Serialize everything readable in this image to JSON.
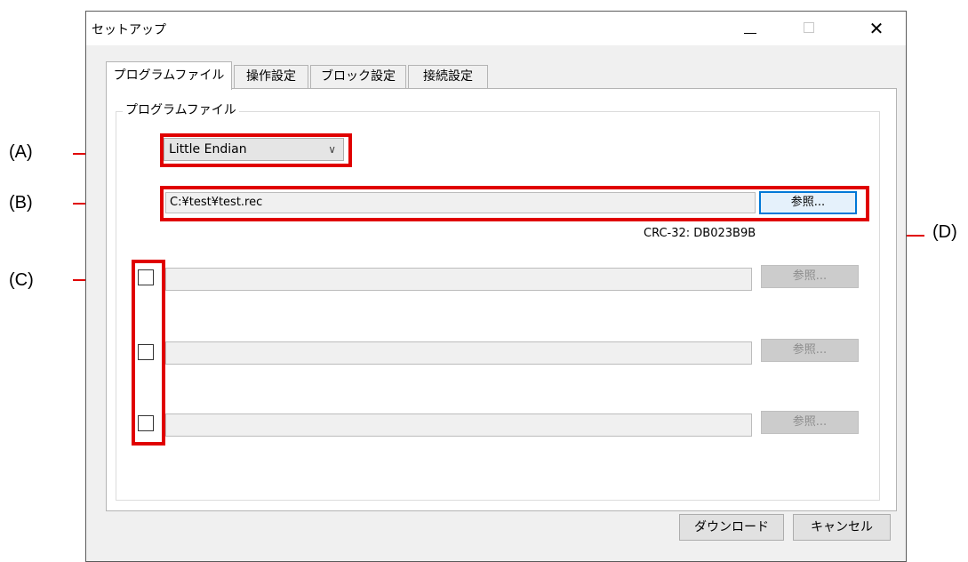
{
  "window": {
    "title": "セットアップ",
    "minimize_glyph": "—",
    "close_glyph": "✕"
  },
  "tabs": [
    {
      "label": "プログラムファイル",
      "active": true
    },
    {
      "label": "操作設定",
      "active": false
    },
    {
      "label": "ブロック設定",
      "active": false
    },
    {
      "label": "接続設定",
      "active": false
    }
  ],
  "group": {
    "label": "プログラムファイル"
  },
  "endian_select": {
    "value": "Little Endian",
    "chevron": "∨"
  },
  "main_file": {
    "path": "C:¥test¥test.rec",
    "browse_label": "参照..."
  },
  "crc": {
    "text": "CRC-32: DB023B9B"
  },
  "extra_files": [
    {
      "checked": false,
      "path": "",
      "browse_label": "参照..."
    },
    {
      "checked": false,
      "path": "",
      "browse_label": "参照..."
    },
    {
      "checked": false,
      "path": "",
      "browse_label": "参照..."
    }
  ],
  "footer": {
    "download_label": "ダウンロード",
    "cancel_label": "キャンセル"
  },
  "callouts": {
    "a": "(A)",
    "b": "(B)",
    "c": "(C)",
    "d": "(D)"
  },
  "colors": {
    "highlight": "#e00000",
    "focus": "#0078d7"
  }
}
